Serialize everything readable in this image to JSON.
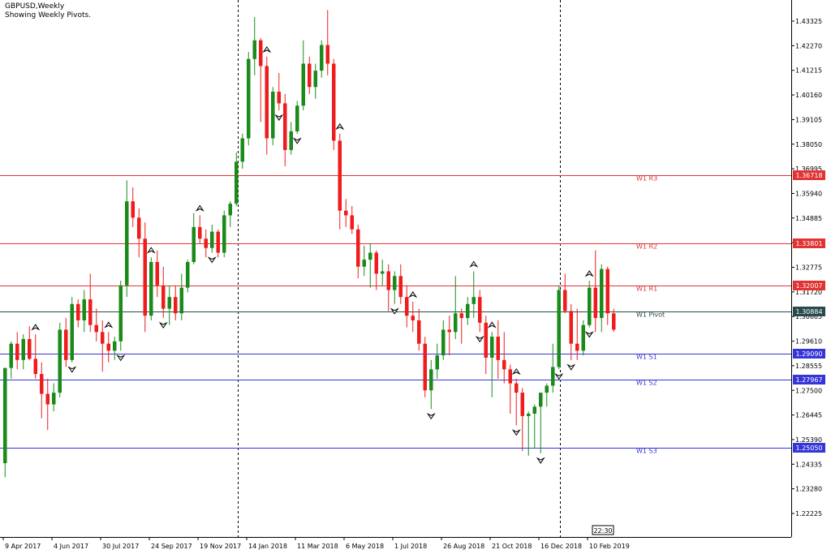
{
  "header": {
    "symbol": "GBPUSD,Weekly",
    "indicator": "Showing Weekly Pivots."
  },
  "colors": {
    "bull": "#1a8a1a",
    "bear": "#ee1c1c",
    "resistance": "#e23333",
    "support": "#3535d8",
    "pivot": "#274a4a",
    "axis": "#000000"
  },
  "chart_data": {
    "type": "candlestick",
    "ylim": [
      1.2175,
      1.44
    ],
    "y_ticks": [
      "1.43325",
      "1.42270",
      "1.41215",
      "1.40160",
      "1.39105",
      "1.38050",
      "1.36995",
      "1.35940",
      "1.34885",
      "1.33830",
      "1.32775",
      "1.31720",
      "1.30665",
      "1.29610",
      "1.28555",
      "1.27500",
      "1.26445",
      "1.25390",
      "1.24335",
      "1.23280",
      "1.22225"
    ],
    "x_labels": [
      {
        "label": "9 Apr 2017",
        "bar": 0
      },
      {
        "label": "4 Jun 2017",
        "bar": 8
      },
      {
        "label": "30 Jul 2017",
        "bar": 16
      },
      {
        "label": "24 Sep 2017",
        "bar": 24
      },
      {
        "label": "19 Nov 2017",
        "bar": 32
      },
      {
        "label": "14 Jan 2018",
        "bar": 40
      },
      {
        "label": "11 Mar 2018",
        "bar": 48
      },
      {
        "label": "6 May 2018",
        "bar": 56
      },
      {
        "label": "1 Jul 2018",
        "bar": 64
      },
      {
        "label": "26 Aug 2018",
        "bar": 72
      },
      {
        "label": "21 Oct 2018",
        "bar": 80
      },
      {
        "label": "16 Dec 2018",
        "bar": 88
      },
      {
        "label": "10 Feb 2019",
        "bar": 96
      }
    ],
    "time_badge": "22:30",
    "period_separators_after_bar": [
      38,
      91
    ],
    "pivots": [
      {
        "name": "W1 R3",
        "value": 1.36718,
        "kind": "resistance",
        "price_label": "1.36718"
      },
      {
        "name": "W1 R2",
        "value": 1.33801,
        "kind": "resistance",
        "price_label": "1.33801"
      },
      {
        "name": "W1 R1",
        "value": 1.32007,
        "kind": "resistance",
        "price_label": "1.32007"
      },
      {
        "name": "W1 Pivot",
        "value": 1.30884,
        "kind": "pivot",
        "price_label": "1.30884"
      },
      {
        "name": "W1 S1",
        "value": 1.2909,
        "kind": "support",
        "price_label": "1.29090"
      },
      {
        "name": "W1 S2",
        "value": 1.27967,
        "kind": "support",
        "price_label": "1.27967"
      },
      {
        "name": "W1 S3",
        "value": 1.2505,
        "kind": "support",
        "price_label": "1.25050"
      }
    ],
    "candles": [
      [
        1.2438,
        1.2846,
        1.2378,
        1.2846
      ],
      [
        1.2846,
        1.296,
        1.28,
        1.295
      ],
      [
        1.295,
        1.3,
        1.284,
        1.288
      ],
      [
        1.288,
        1.299,
        1.284,
        1.297
      ],
      [
        1.297,
        1.3025,
        1.288,
        1.2885
      ],
      [
        1.2885,
        1.299,
        1.28,
        1.282
      ],
      [
        1.282,
        1.287,
        1.263,
        1.2735
      ],
      [
        1.2735,
        1.28,
        1.258,
        1.269
      ],
      [
        1.269,
        1.278,
        1.266,
        1.274
      ],
      [
        1.274,
        1.304,
        1.272,
        1.301
      ],
      [
        1.301,
        1.306,
        1.285,
        1.288
      ],
      [
        1.288,
        1.315,
        1.287,
        1.312
      ],
      [
        1.312,
        1.314,
        1.302,
        1.305
      ],
      [
        1.305,
        1.318,
        1.3,
        1.314
      ],
      [
        1.314,
        1.325,
        1.3,
        1.303
      ],
      [
        1.303,
        1.31,
        1.296,
        1.3
      ],
      [
        1.3,
        1.305,
        1.283,
        1.295
      ],
      [
        1.295,
        1.3,
        1.287,
        1.292
      ],
      [
        1.292,
        1.298,
        1.288,
        1.296
      ],
      [
        1.296,
        1.322,
        1.292,
        1.32
      ],
      [
        1.32,
        1.365,
        1.315,
        1.356
      ],
      [
        1.356,
        1.362,
        1.345,
        1.349
      ],
      [
        1.349,
        1.353,
        1.332,
        1.34
      ],
      [
        1.34,
        1.347,
        1.3,
        1.307
      ],
      [
        1.307,
        1.332,
        1.305,
        1.33
      ],
      [
        1.33,
        1.335,
        1.315,
        1.32
      ],
      [
        1.32,
        1.328,
        1.306,
        1.31
      ],
      [
        1.31,
        1.32,
        1.303,
        1.315
      ],
      [
        1.315,
        1.32,
        1.305,
        1.308
      ],
      [
        1.308,
        1.325,
        1.305,
        1.319
      ],
      [
        1.319,
        1.331,
        1.317,
        1.33
      ],
      [
        1.33,
        1.351,
        1.329,
        1.345
      ],
      [
        1.345,
        1.35,
        1.338,
        1.34
      ],
      [
        1.34,
        1.344,
        1.332,
        1.336
      ],
      [
        1.336,
        1.346,
        1.334,
        1.343
      ],
      [
        1.343,
        1.344,
        1.332,
        1.334
      ],
      [
        1.334,
        1.352,
        1.332,
        1.35
      ],
      [
        1.35,
        1.356,
        1.345,
        1.355
      ],
      [
        1.355,
        1.377,
        1.354,
        1.373
      ],
      [
        1.373,
        1.385,
        1.37,
        1.383
      ],
      [
        1.383,
        1.42,
        1.38,
        1.417
      ],
      [
        1.417,
        1.435,
        1.41,
        1.425
      ],
      [
        1.425,
        1.426,
        1.39,
        1.414
      ],
      [
        1.414,
        1.418,
        1.376,
        1.383
      ],
      [
        1.383,
        1.405,
        1.38,
        1.403
      ],
      [
        1.403,
        1.411,
        1.395,
        1.398
      ],
      [
        1.398,
        1.402,
        1.371,
        1.378
      ],
      [
        1.378,
        1.39,
        1.376,
        1.386
      ],
      [
        1.386,
        1.399,
        1.385,
        1.397
      ],
      [
        1.397,
        1.425,
        1.395,
        1.415
      ],
      [
        1.415,
        1.418,
        1.402,
        1.405
      ],
      [
        1.405,
        1.415,
        1.4,
        1.412
      ],
      [
        1.412,
        1.425,
        1.409,
        1.423
      ],
      [
        1.423,
        1.438,
        1.41,
        1.415
      ],
      [
        1.415,
        1.417,
        1.378,
        1.382
      ],
      [
        1.382,
        1.385,
        1.344,
        1.352
      ],
      [
        1.352,
        1.357,
        1.345,
        1.35
      ],
      [
        1.35,
        1.354,
        1.342,
        1.344
      ],
      [
        1.344,
        1.346,
        1.323,
        1.328
      ],
      [
        1.328,
        1.337,
        1.324,
        1.331
      ],
      [
        1.331,
        1.338,
        1.319,
        1.334
      ],
      [
        1.334,
        1.335,
        1.318,
        1.325
      ],
      [
        1.325,
        1.331,
        1.32,
        1.326
      ],
      [
        1.326,
        1.329,
        1.309,
        1.318
      ],
      [
        1.318,
        1.326,
        1.312,
        1.324
      ],
      [
        1.324,
        1.329,
        1.312,
        1.315
      ],
      [
        1.315,
        1.32,
        1.302,
        1.307
      ],
      [
        1.307,
        1.313,
        1.3,
        1.305
      ],
      [
        1.305,
        1.31,
        1.292,
        1.295
      ],
      [
        1.295,
        1.298,
        1.272,
        1.275
      ],
      [
        1.275,
        1.288,
        1.267,
        1.284
      ],
      [
        1.284,
        1.295,
        1.28,
        1.29
      ],
      [
        1.29,
        1.305,
        1.288,
        1.301
      ],
      [
        1.301,
        1.307,
        1.29,
        1.3
      ],
      [
        1.3,
        1.324,
        1.297,
        1.308
      ],
      [
        1.308,
        1.31,
        1.295,
        1.306
      ],
      [
        1.306,
        1.315,
        1.303,
        1.312
      ],
      [
        1.312,
        1.326,
        1.306,
        1.315
      ],
      [
        1.315,
        1.318,
        1.3,
        1.304
      ],
      [
        1.304,
        1.307,
        1.282,
        1.289
      ],
      [
        1.289,
        1.3,
        1.272,
        1.298
      ],
      [
        1.298,
        1.305,
        1.28,
        1.288
      ],
      [
        1.288,
        1.3,
        1.278,
        1.284
      ],
      [
        1.284,
        1.286,
        1.265,
        1.278
      ],
      [
        1.278,
        1.28,
        1.26,
        1.274
      ],
      [
        1.274,
        1.276,
        1.249,
        1.264
      ],
      [
        1.264,
        1.266,
        1.247,
        1.265
      ],
      [
        1.265,
        1.269,
        1.25,
        1.268
      ],
      [
        1.268,
        1.274,
        1.248,
        1.274
      ],
      [
        1.274,
        1.278,
        1.268,
        1.277
      ],
      [
        1.277,
        1.295,
        1.274,
        1.285
      ],
      [
        1.285,
        1.32,
        1.284,
        1.318
      ],
      [
        1.318,
        1.325,
        1.308,
        1.309
      ],
      [
        1.309,
        1.312,
        1.288,
        1.295
      ],
      [
        1.295,
        1.31,
        1.288,
        1.292
      ],
      [
        1.292,
        1.305,
        1.29,
        1.303
      ],
      [
        1.303,
        1.322,
        1.302,
        1.319
      ],
      [
        1.319,
        1.335,
        1.3,
        1.306
      ],
      [
        1.306,
        1.329,
        1.3,
        1.327
      ],
      [
        1.327,
        1.328,
        1.303,
        1.308
      ],
      [
        1.308,
        1.31,
        1.3,
        1.301
      ]
    ],
    "fractal_up_bars": [
      5,
      17,
      24,
      32,
      43,
      55,
      67,
      77,
      80,
      84,
      96
    ],
    "fractal_down_bars": [
      11,
      19,
      26,
      34,
      45,
      48,
      64,
      70,
      78,
      84,
      88,
      91,
      93,
      96
    ]
  }
}
